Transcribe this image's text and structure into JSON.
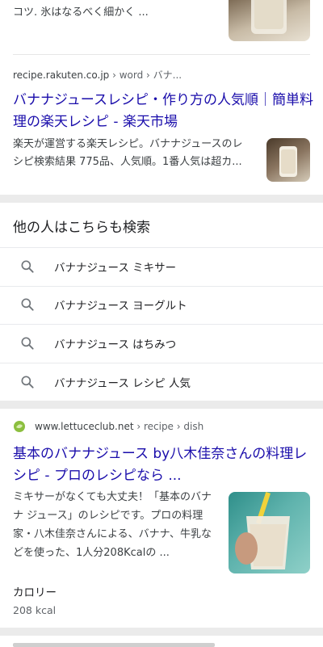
{
  "result_top": {
    "snippet_line1": "コツ. 氷はなるべく細かく ..."
  },
  "result_rakuten": {
    "source": "recipe.rakuten.co.jp",
    "path": " › word › バナ...",
    "title": "バナナジュースレシピ・作り方の人気順｜簡単料理の楽天レシピ - 楽天市場",
    "snippet": "楽天が運営する楽天レシピ。バナナジュースのレシピ検索結果 775品、人気順。1番人気は超カ..."
  },
  "people_also_search": {
    "heading": "他の人はこちらも検索",
    "items": [
      {
        "label": "バナナジュース ミキサー",
        "icon": "search-icon"
      },
      {
        "label": "バナナジュース ヨーグルト",
        "icon": "search-icon"
      },
      {
        "label": "バナナジュース はちみつ",
        "icon": "search-icon"
      },
      {
        "label": "バナナジュース レシピ 人気",
        "icon": "search-icon"
      }
    ]
  },
  "result_lettuce": {
    "source": "www.lettuceclub.net",
    "path": " › recipe › dish",
    "title": "基本のバナナジュース by八木佳奈さんの料理レシピ - プロのレシピなら ...",
    "snippet": "ミキサーがなくても大丈夫！「基本のバナナ ジュース」のレシピです。プロの料理家・八木佳奈さんによる、バナナ、牛乳などを使った、1人分208Kcalの ...",
    "calorie_label": "カロリー",
    "calorie_value": "208 kcal"
  },
  "colors": {
    "link": "#1a0dab",
    "text": "#202124",
    "muted": "#3c4043",
    "divider": "#ebebeb"
  }
}
